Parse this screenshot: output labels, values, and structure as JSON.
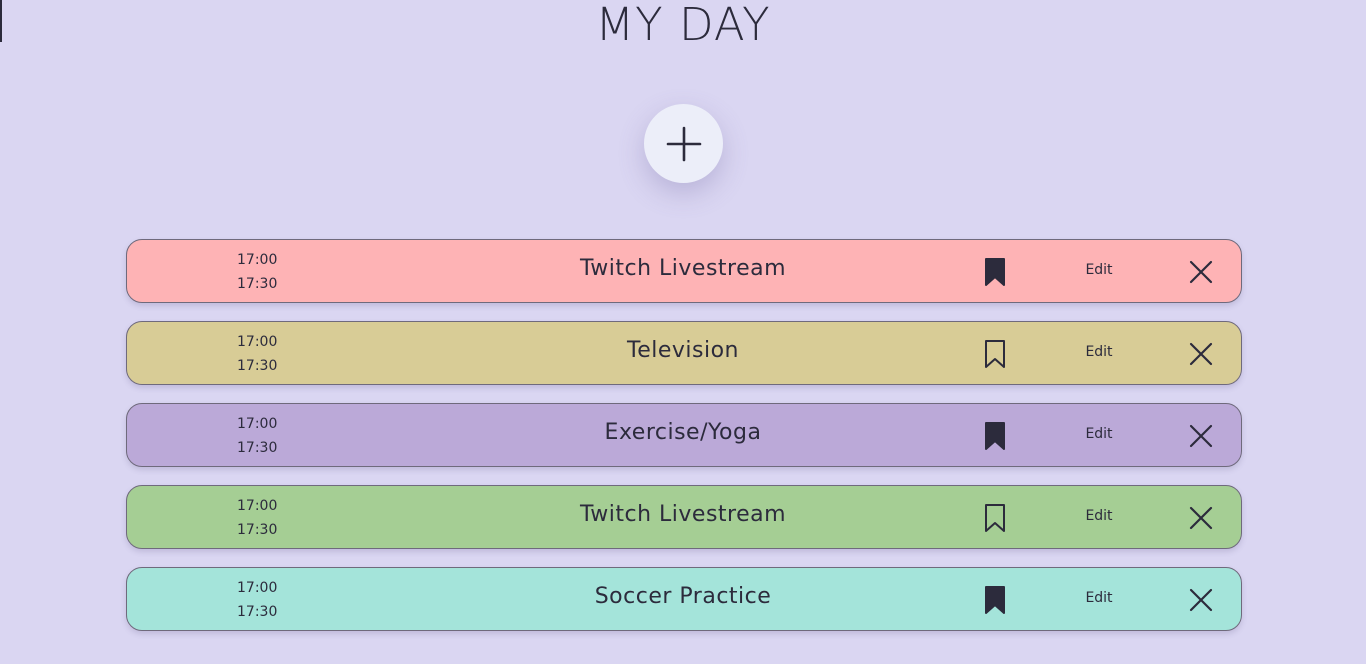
{
  "page": {
    "title": "MY DAY"
  },
  "add_button": {
    "icon": "plus-icon"
  },
  "colors": {
    "background": "#dad6f2",
    "text": "#2c2b3c",
    "add_button_bg": "#eceef9"
  },
  "tasks": [
    {
      "start": "17:00",
      "end": "17:30",
      "name": "Twitch Livestream",
      "bookmarked": true,
      "edit_label": "Edit",
      "color": "#feb3b5"
    },
    {
      "start": "17:00",
      "end": "17:30",
      "name": "Television",
      "bookmarked": false,
      "edit_label": "Edit",
      "color": "#d8cc96"
    },
    {
      "start": "17:00",
      "end": "17:30",
      "name": "Exercise/Yoga",
      "bookmarked": true,
      "edit_label": "Edit",
      "color": "#bba9d8"
    },
    {
      "start": "17:00",
      "end": "17:30",
      "name": "Twitch Livestream",
      "bookmarked": false,
      "edit_label": "Edit",
      "color": "#a5ce94"
    },
    {
      "start": "17:00",
      "end": "17:30",
      "name": "Soccer Practice",
      "bookmarked": true,
      "edit_label": "Edit",
      "color": "#a4e4da"
    }
  ]
}
